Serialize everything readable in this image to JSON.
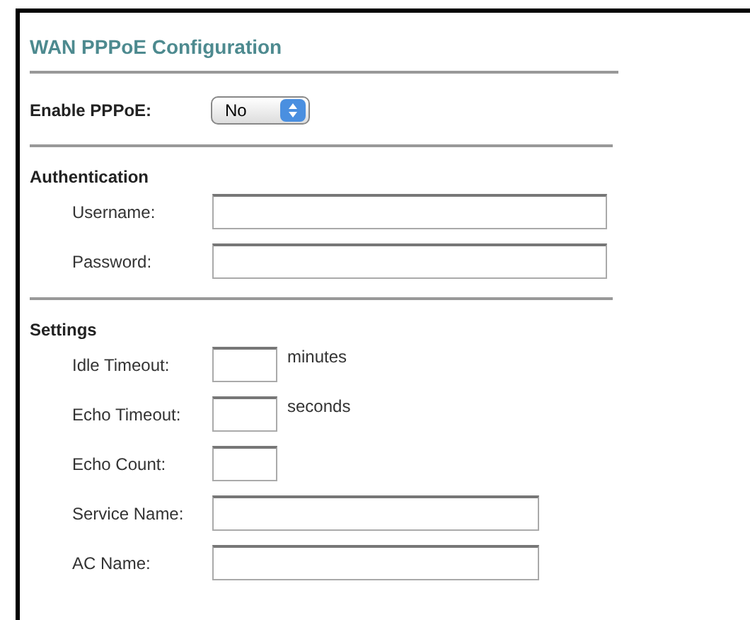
{
  "title": "WAN PPPoE Configuration",
  "enable": {
    "label": "Enable PPPoE:",
    "value": "No"
  },
  "sections": [
    {
      "heading": "Authentication",
      "fields": [
        {
          "label": "Username:",
          "kind": "wide"
        },
        {
          "label": "Password:",
          "kind": "wide"
        }
      ]
    },
    {
      "heading": "Settings",
      "fields": [
        {
          "label": "Idle Timeout:",
          "kind": "short",
          "unit": "minutes"
        },
        {
          "label": "Echo Timeout:",
          "kind": "short",
          "unit": "seconds"
        },
        {
          "label": "Echo Count:",
          "kind": "short"
        },
        {
          "label": "Service Name:",
          "kind": "medium"
        },
        {
          "label": "AC Name:",
          "kind": "medium"
        }
      ]
    }
  ]
}
